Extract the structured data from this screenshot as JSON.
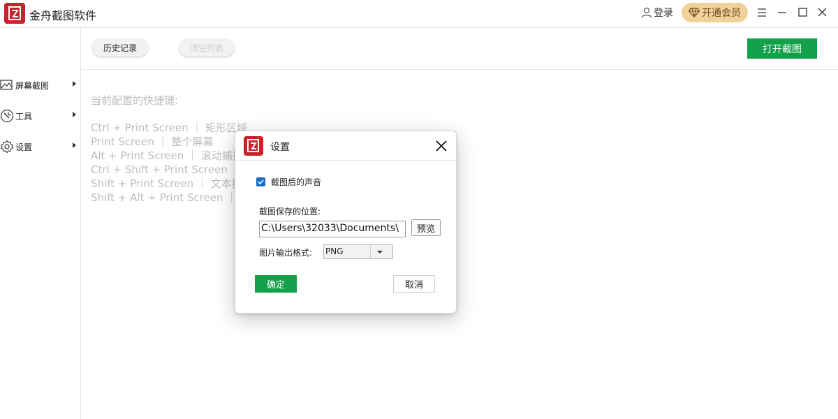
{
  "app": {
    "title": "金舟截图软件"
  },
  "header": {
    "login_label": "登录",
    "vip_label": "开通会员",
    "menu_icon": "hamburger-icon",
    "minimize_icon": "minimize-icon",
    "maximize_icon": "maximize-icon",
    "close_icon": "close-icon"
  },
  "sidebar": {
    "items": [
      {
        "label": "屏幕截图",
        "icon": "screenshot-icon"
      },
      {
        "label": "工具",
        "icon": "wrench-icon"
      },
      {
        "label": "设置",
        "icon": "gear-icon"
      }
    ]
  },
  "toolbar": {
    "history_label": "历史记录",
    "clear_label": "清空列表",
    "open_label": "打开截图"
  },
  "hotkeys": {
    "title": "当前配置的快捷键:",
    "rows": [
      "Ctrl + Print Screen ｜ 矩形区域",
      "Print Screen ｜ 整个屏幕",
      "Alt + Print Screen ｜ 滚动捕捉",
      "Ctrl + Shift + Print Screen ｜ 局",
      "Shift + Print Screen ｜ 文本捕",
      "Shift + Alt + Print Screen ｜ 自"
    ]
  },
  "dialog": {
    "title": "设置",
    "sound_label": "截图后的声音",
    "sound_checked": true,
    "save_location_label": "截图保存的位置:",
    "save_path": "C:\\Users\\32033\\Documents\\",
    "browse_label": "预览",
    "format_label": "图片输出格式:",
    "format_value": "PNG",
    "ok_label": "确定",
    "cancel_label": "取消"
  },
  "colors": {
    "brand_red": "#c8222a",
    "primary_green": "#12a14a",
    "vip_gold": "#f0d19a",
    "checkbox_blue": "#1a6fc9"
  }
}
